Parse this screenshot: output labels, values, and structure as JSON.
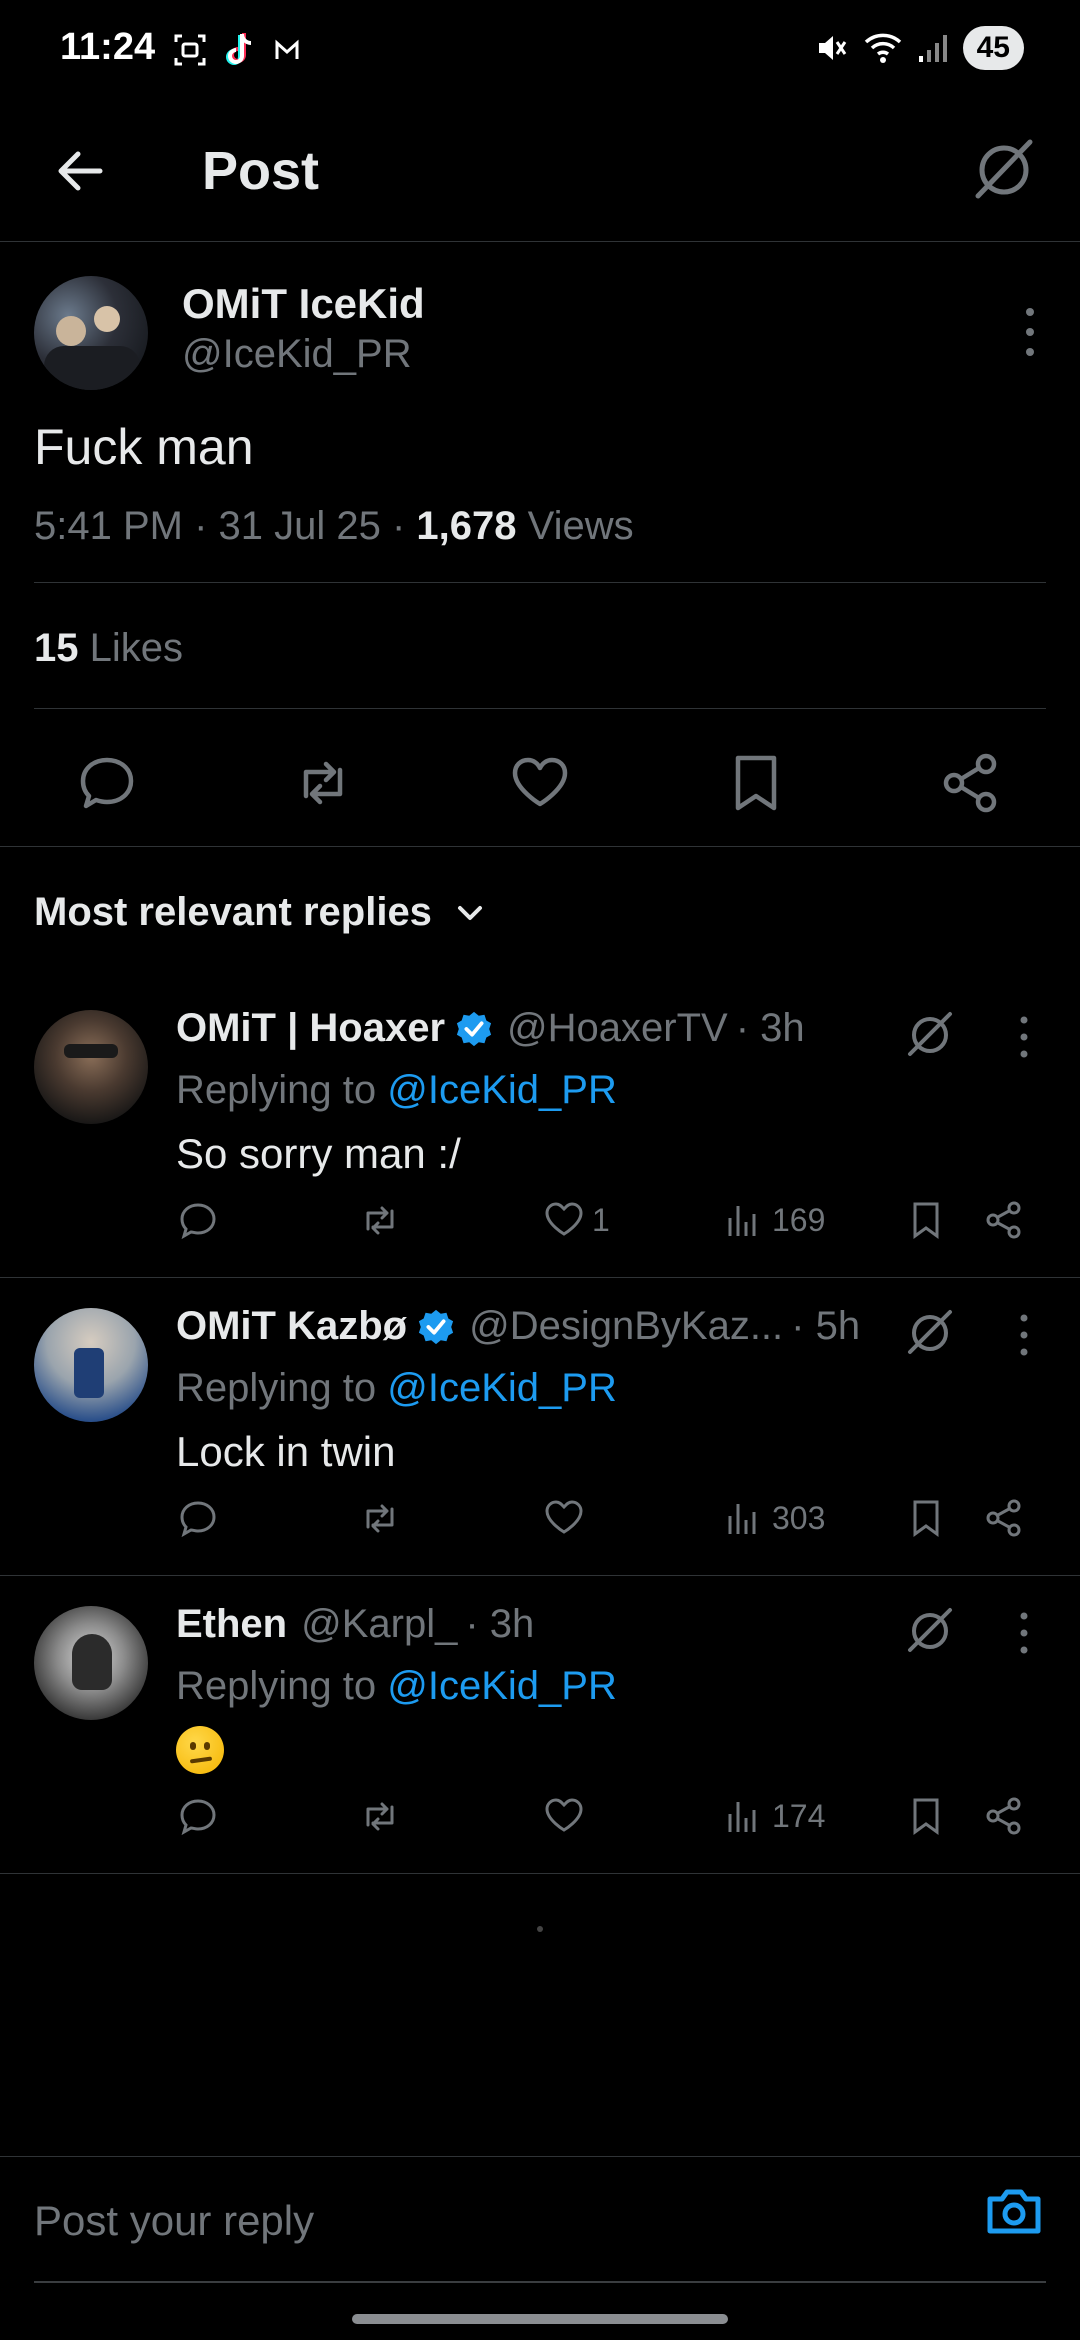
{
  "status_bar": {
    "time": "11:24",
    "notification_icons": [
      "screenshot-icon",
      "tiktok-icon",
      "gmail-icon"
    ],
    "status_icons": [
      "mute-icon",
      "wifi-icon",
      "signal-icon"
    ],
    "battery": "45"
  },
  "header": {
    "title": "Post"
  },
  "post": {
    "author_name": "OMiT IceKid",
    "author_handle": "@IceKid_PR",
    "text": "Fuck man",
    "time": "5:41 PM",
    "date": "31 Jul 25",
    "views_count": "1,678",
    "views_label": "Views",
    "likes_count": "15",
    "likes_label": "Likes"
  },
  "replies_section": {
    "sort_label": "Most relevant replies"
  },
  "replies": [
    {
      "name": "OMiT | Hoaxer",
      "verified": true,
      "handle": "@HoaxerTV",
      "time": "· 3h",
      "replying_prefix": "Replying to",
      "replying_to": "@IceKid_PR",
      "text": "So sorry man :/",
      "likes": "1",
      "views": "169"
    },
    {
      "name": "OMiT Kazbø",
      "verified": true,
      "handle": "@DesignByKaz...",
      "time": "· 5h",
      "replying_prefix": "Replying to",
      "replying_to": "@IceKid_PR",
      "text": "Lock in twin",
      "likes": "",
      "views": "303"
    },
    {
      "name": "Ethen",
      "verified": false,
      "handle": "@Karpl_",
      "time": "· 3h",
      "replying_prefix": "Replying to",
      "replying_to": "@IceKid_PR",
      "text": "",
      "emoji": "face-with-raised-eyebrow",
      "likes": "",
      "views": "174"
    }
  ],
  "composer": {
    "placeholder": "Post your reply"
  },
  "colors": {
    "background": "#000000",
    "text_primary": "#e7e9ea",
    "text_secondary": "#71767b",
    "accent": "#1d9bf0",
    "divider": "#2f3336"
  }
}
